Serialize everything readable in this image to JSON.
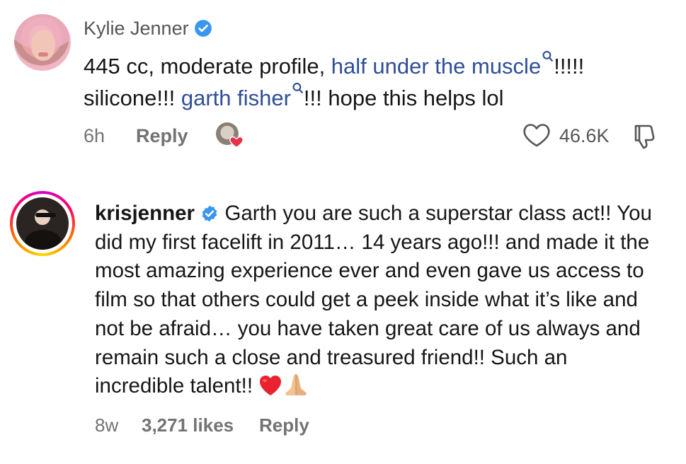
{
  "comments": [
    {
      "username": "Kylie Jenner",
      "verified": true,
      "text_parts": [
        {
          "text": "445 cc, moderate profile, ",
          "link": false
        },
        {
          "text": "half under the muscle",
          "link": true
        },
        {
          "text": "!!!!! silicone!!! ",
          "link": false
        },
        {
          "text": "garth fisher",
          "link": true
        },
        {
          "text": "!!! hope this helps lol",
          "link": false
        }
      ],
      "time": "6h",
      "reply_label": "Reply",
      "like_count": "46.6K",
      "icons": {
        "like": "heart-outline-icon",
        "dislike": "thumbs-down-icon",
        "creator_liked": "creator-liked-heart-icon",
        "search_suggestion": "search-icon"
      }
    },
    {
      "username": "krisjenner",
      "verified": true,
      "text": "Garth you are such a superstar class act!! You did my first facelift in 2011… 14 years ago!!! and made it the most amazing experience ever and even gave us access to film so that others could get a peek inside what it’s like and not be afraid… you have taken great care of us always and remain such a close and treasured friend!! Such an incredible talent!!",
      "emojis": [
        "red-heart-emoji",
        "folded-hands-emoji"
      ],
      "time": "8w",
      "likes_label": "3,271 likes",
      "reply_label": "Reply",
      "has_story_ring": true
    }
  ],
  "colors": {
    "link": "#2f4e96",
    "verified": "#3897f0",
    "muted_text": "#737373",
    "primary_text": "#161616",
    "heart": "#e8304a"
  }
}
